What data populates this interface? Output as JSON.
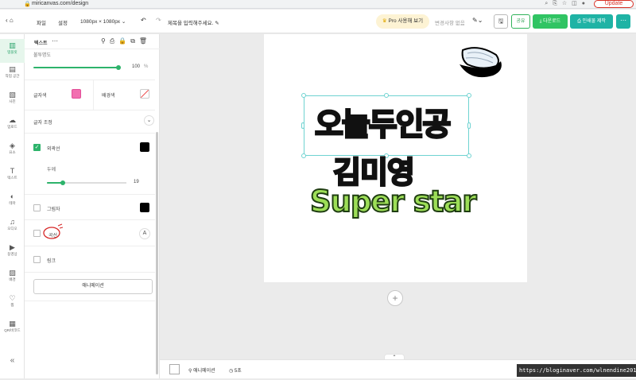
{
  "browser": {
    "url": "miricanvas.com/design",
    "update_label": "Update"
  },
  "header": {
    "menu_file": "파일",
    "menu_settings": "설정",
    "size_label": "1080px × 1080px",
    "title_placeholder": "제목을 입력해주세요.",
    "pro_button": "Pro 사용해 보기",
    "changes_status": "변경사항 없음",
    "share_button": "공유",
    "download_button": "다운로드",
    "print_button": "인쇄물 제작"
  },
  "rail": {
    "items": [
      {
        "label": "템플릿",
        "icon": "template-icon",
        "glyph": "▥"
      },
      {
        "label": "작업 공간",
        "icon": "workspace-icon",
        "glyph": "▤"
      },
      {
        "label": "사진",
        "icon": "photo-icon",
        "glyph": "▧"
      },
      {
        "label": "업로드",
        "icon": "upload-icon",
        "glyph": "☁"
      },
      {
        "label": "요소",
        "icon": "elements-icon",
        "glyph": "◈"
      },
      {
        "label": "텍스트",
        "icon": "text-icon",
        "glyph": "T"
      },
      {
        "label": "테마",
        "icon": "theme-icon",
        "glyph": "◐"
      },
      {
        "label": "오디오",
        "icon": "audio-icon",
        "glyph": "♫"
      },
      {
        "label": "동영상",
        "icon": "video-icon",
        "glyph": "▶"
      },
      {
        "label": "배경",
        "icon": "background-icon",
        "glyph": "▨"
      },
      {
        "label": "찜",
        "icon": "heart-icon",
        "glyph": "♡"
      },
      {
        "label": "QR/바코드",
        "icon": "qr-icon",
        "glyph": "▦"
      }
    ],
    "collapse_glyph": "«"
  },
  "panel": {
    "title": "텍스트",
    "opacity_label": "불투명도",
    "opacity_value": "100",
    "opacity_unit": "%",
    "opacity_fraction": 1.0,
    "font_color_label": "글자색",
    "bg_color_label": "배경색",
    "letter_adjust_label": "글자 조정",
    "outline_label": "외곽선",
    "outline_checked": true,
    "thickness_label": "두께",
    "thickness_value": "19",
    "thickness_fraction": 0.2,
    "shadow_label": "그림자",
    "curve_label": "곡선",
    "link_label": "링크",
    "animation_button": "애니메이션"
  },
  "canvas": {
    "line1": "오늘두인공",
    "line2": "김미영",
    "line3": "Super star"
  },
  "bottom": {
    "animation_label": "애니메이션",
    "duration_label": "5초"
  },
  "watermark": "https://bloginaver.com/wlnendine2017",
  "colors": {
    "accent": "#2db36b",
    "font_swatch": "#f26fb0",
    "outline_swatch": "#000000",
    "selection": "#6fd3d1"
  }
}
